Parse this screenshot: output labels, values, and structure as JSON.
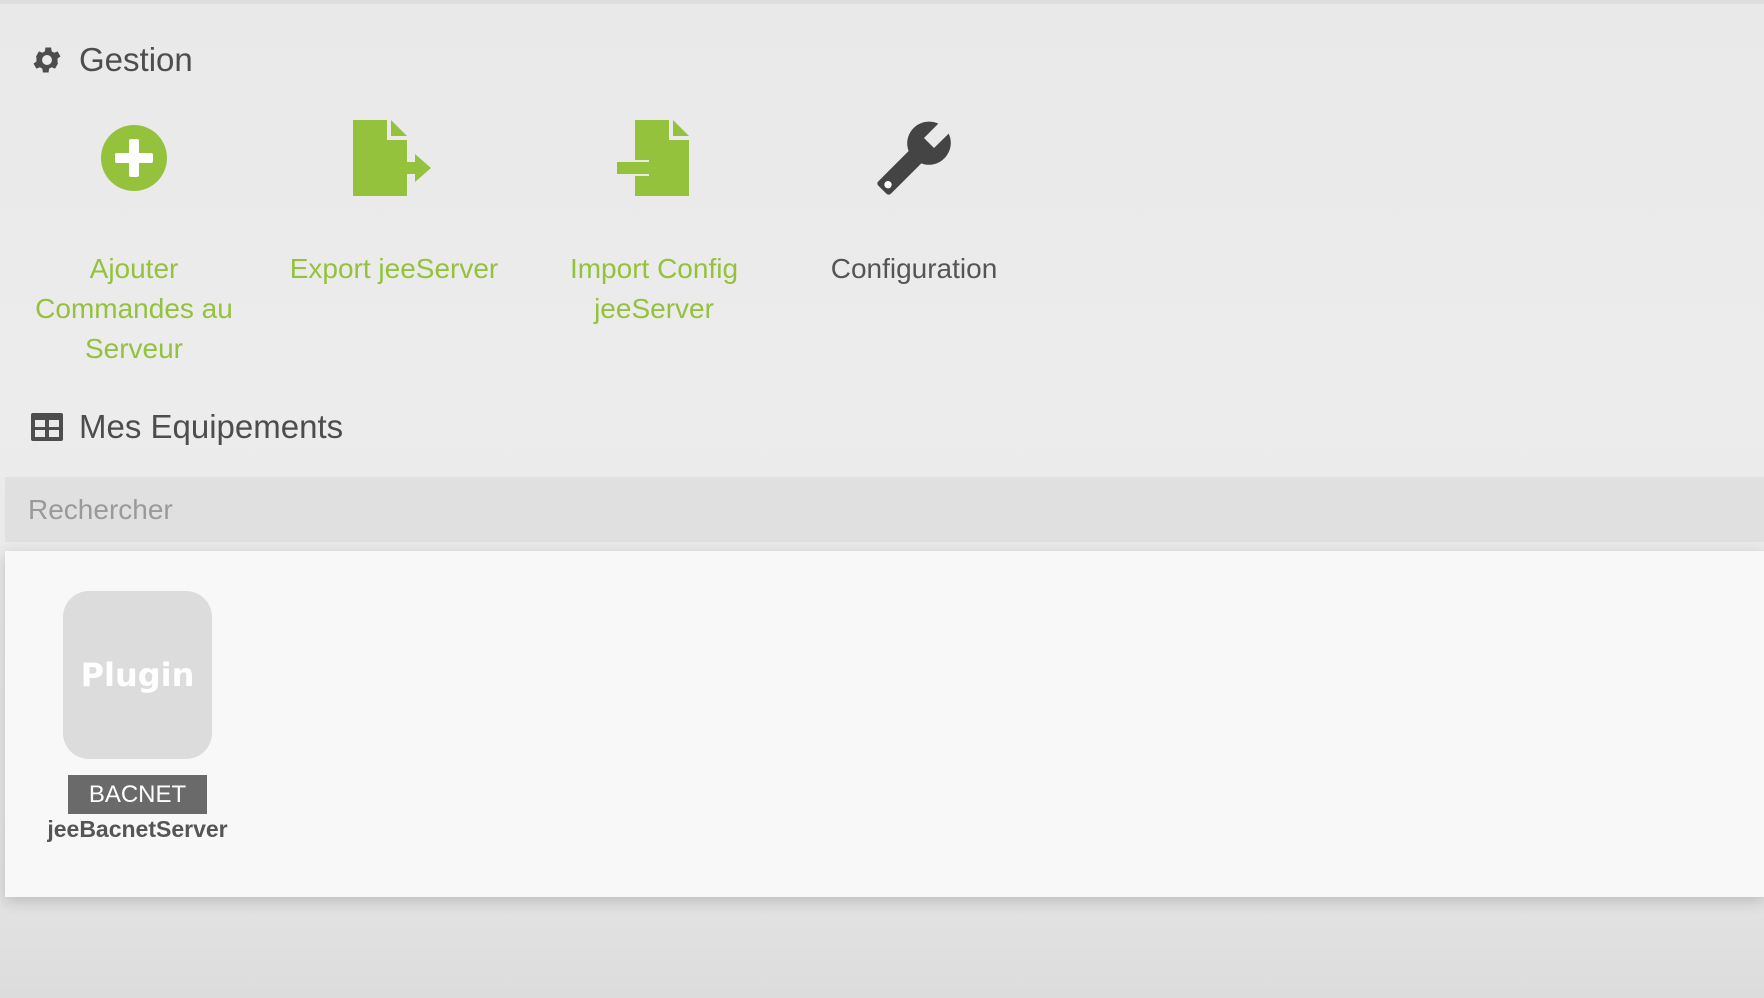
{
  "gestion": {
    "title": "Gestion",
    "actions": [
      {
        "label": "Ajouter Commandes au Serveur",
        "icon": "plus-circle-icon",
        "color": "#94c23d"
      },
      {
        "label": "Export jeeServer",
        "icon": "file-export-icon",
        "color": "#94c23d"
      },
      {
        "label": "Import Config jeeServer",
        "icon": "file-import-icon",
        "color": "#94c23d"
      },
      {
        "label": "Configuration",
        "icon": "wrench-icon",
        "color": "#555555"
      }
    ]
  },
  "equipements": {
    "title": "Mes Equipements",
    "search_placeholder": "Rechercher",
    "items": [
      {
        "thumb_text": "Plugin",
        "badge": "BACNET",
        "name": "jeeBacnetServer"
      }
    ]
  },
  "colors": {
    "accent": "#94c23d",
    "text": "#555555",
    "badge_bg": "#6a6a6a"
  }
}
